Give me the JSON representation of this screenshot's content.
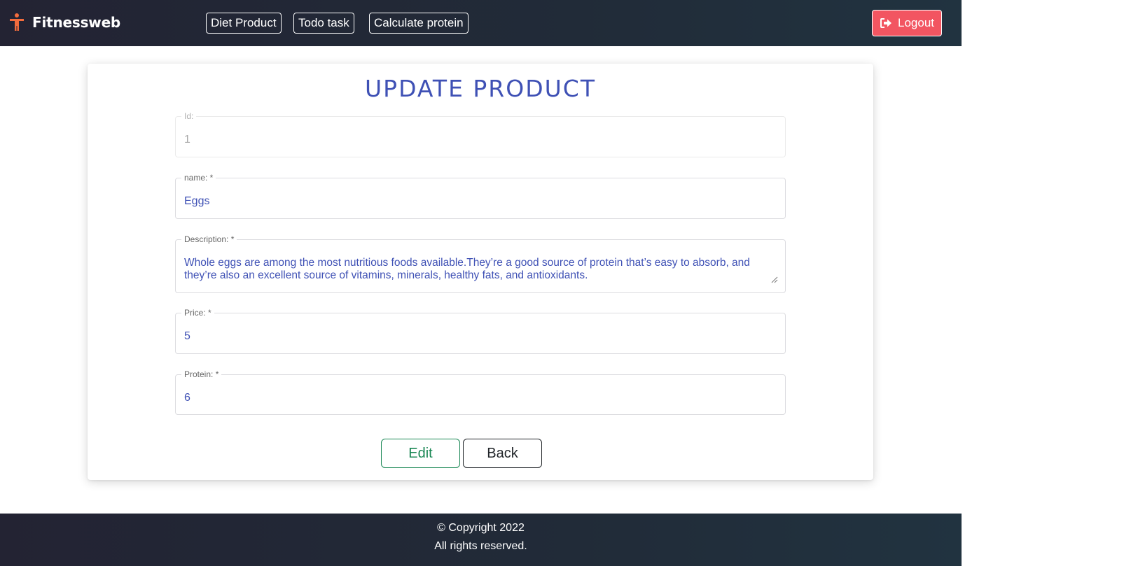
{
  "header": {
    "brand": "Fitnessweb",
    "brand_icon": "accessibility-person-icon",
    "brand_icon_color": "#f36c3d",
    "nav": [
      {
        "label": "Diet Product"
      },
      {
        "label": "Todo task"
      },
      {
        "label": "Calculate protein"
      }
    ],
    "logout_label": "Logout",
    "logout_icon": "sign-out-icon",
    "logout_color": "#f25561"
  },
  "form": {
    "title": "UPDATE PRODUCT",
    "id_field": {
      "label": "Id:",
      "value": "1",
      "disabled": true
    },
    "name_field": {
      "label": "name: *",
      "value": "Eggs"
    },
    "description_field": {
      "label": "Description: *",
      "value": "Whole eggs are among the most nutritious foods available.They’re a good source of protein that’s easy to absorb, and they’re also an excellent source of vitamins, minerals, healthy fats, and antioxidants."
    },
    "price_field": {
      "label": "Price: *",
      "value": "5"
    },
    "protein_field": {
      "label": "Protein: *",
      "value": "6"
    },
    "edit_label": "Edit",
    "back_label": "Back",
    "accent_color": "#3f51b5",
    "edit_color": "#198754"
  },
  "footer": {
    "copyright": "© Copyright 2022",
    "rights": "All rights reserved."
  }
}
